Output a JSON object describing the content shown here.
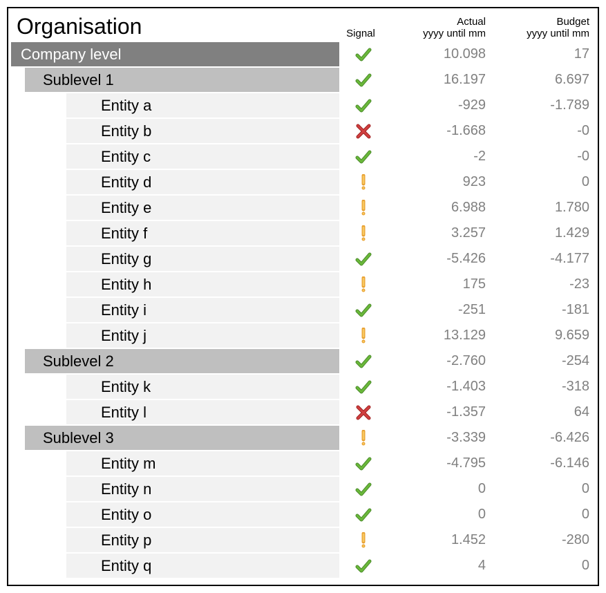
{
  "title": "Organisation",
  "columns": {
    "signal": "Signal",
    "actual_line1": "Actual",
    "actual_line2": "yyyy until mm",
    "budget_line1": "Budget",
    "budget_line2": "yyyy until mm"
  },
  "rows": [
    {
      "label": "Company level",
      "level": "company",
      "signal": "check",
      "actual": "10.098",
      "budget": "17"
    },
    {
      "label": "Sublevel 1",
      "level": "sub",
      "signal": "check",
      "actual": "16.197",
      "budget": "6.697"
    },
    {
      "label": "Entity a",
      "level": "entity",
      "signal": "check",
      "actual": "-929",
      "budget": "-1.789"
    },
    {
      "label": "Entity b",
      "level": "entity",
      "signal": "cross",
      "actual": "-1.668",
      "budget": "-0"
    },
    {
      "label": "Entity c",
      "level": "entity",
      "signal": "check",
      "actual": "-2",
      "budget": "-0"
    },
    {
      "label": "Entity d",
      "level": "entity",
      "signal": "warn",
      "actual": "923",
      "budget": "0"
    },
    {
      "label": "Entity e",
      "level": "entity",
      "signal": "warn",
      "actual": "6.988",
      "budget": "1.780"
    },
    {
      "label": "Entity f",
      "level": "entity",
      "signal": "warn",
      "actual": "3.257",
      "budget": "1.429"
    },
    {
      "label": "Entity g",
      "level": "entity",
      "signal": "check",
      "actual": "-5.426",
      "budget": "-4.177"
    },
    {
      "label": "Entity h",
      "level": "entity",
      "signal": "warn",
      "actual": "175",
      "budget": "-23"
    },
    {
      "label": "Entity i",
      "level": "entity",
      "signal": "check",
      "actual": "-251",
      "budget": "-181"
    },
    {
      "label": "Entity j",
      "level": "entity",
      "signal": "warn",
      "actual": "13.129",
      "budget": "9.659"
    },
    {
      "label": "Sublevel 2",
      "level": "sub",
      "signal": "check",
      "actual": "-2.760",
      "budget": "-254"
    },
    {
      "label": "Entity k",
      "level": "entity",
      "signal": "check",
      "actual": "-1.403",
      "budget": "-318"
    },
    {
      "label": "Entity l",
      "level": "entity",
      "signal": "cross",
      "actual": "-1.357",
      "budget": "64"
    },
    {
      "label": "Sublevel 3",
      "level": "sub",
      "signal": "warn",
      "actual": "-3.339",
      "budget": "-6.426"
    },
    {
      "label": "Entity m",
      "level": "entity",
      "signal": "check",
      "actual": "-4.795",
      "budget": "-6.146"
    },
    {
      "label": "Entity n",
      "level": "entity",
      "signal": "check",
      "actual": "0",
      "budget": "0"
    },
    {
      "label": "Entity o",
      "level": "entity",
      "signal": "check",
      "actual": "0",
      "budget": "0"
    },
    {
      "label": "Entity p",
      "level": "entity",
      "signal": "warn",
      "actual": "1.452",
      "budget": "-280"
    },
    {
      "label": "Entity q",
      "level": "entity",
      "signal": "check",
      "actual": "4",
      "budget": "0"
    }
  ],
  "icons": {
    "check": "check-icon",
    "cross": "cross-icon",
    "warn": "warning-icon"
  }
}
